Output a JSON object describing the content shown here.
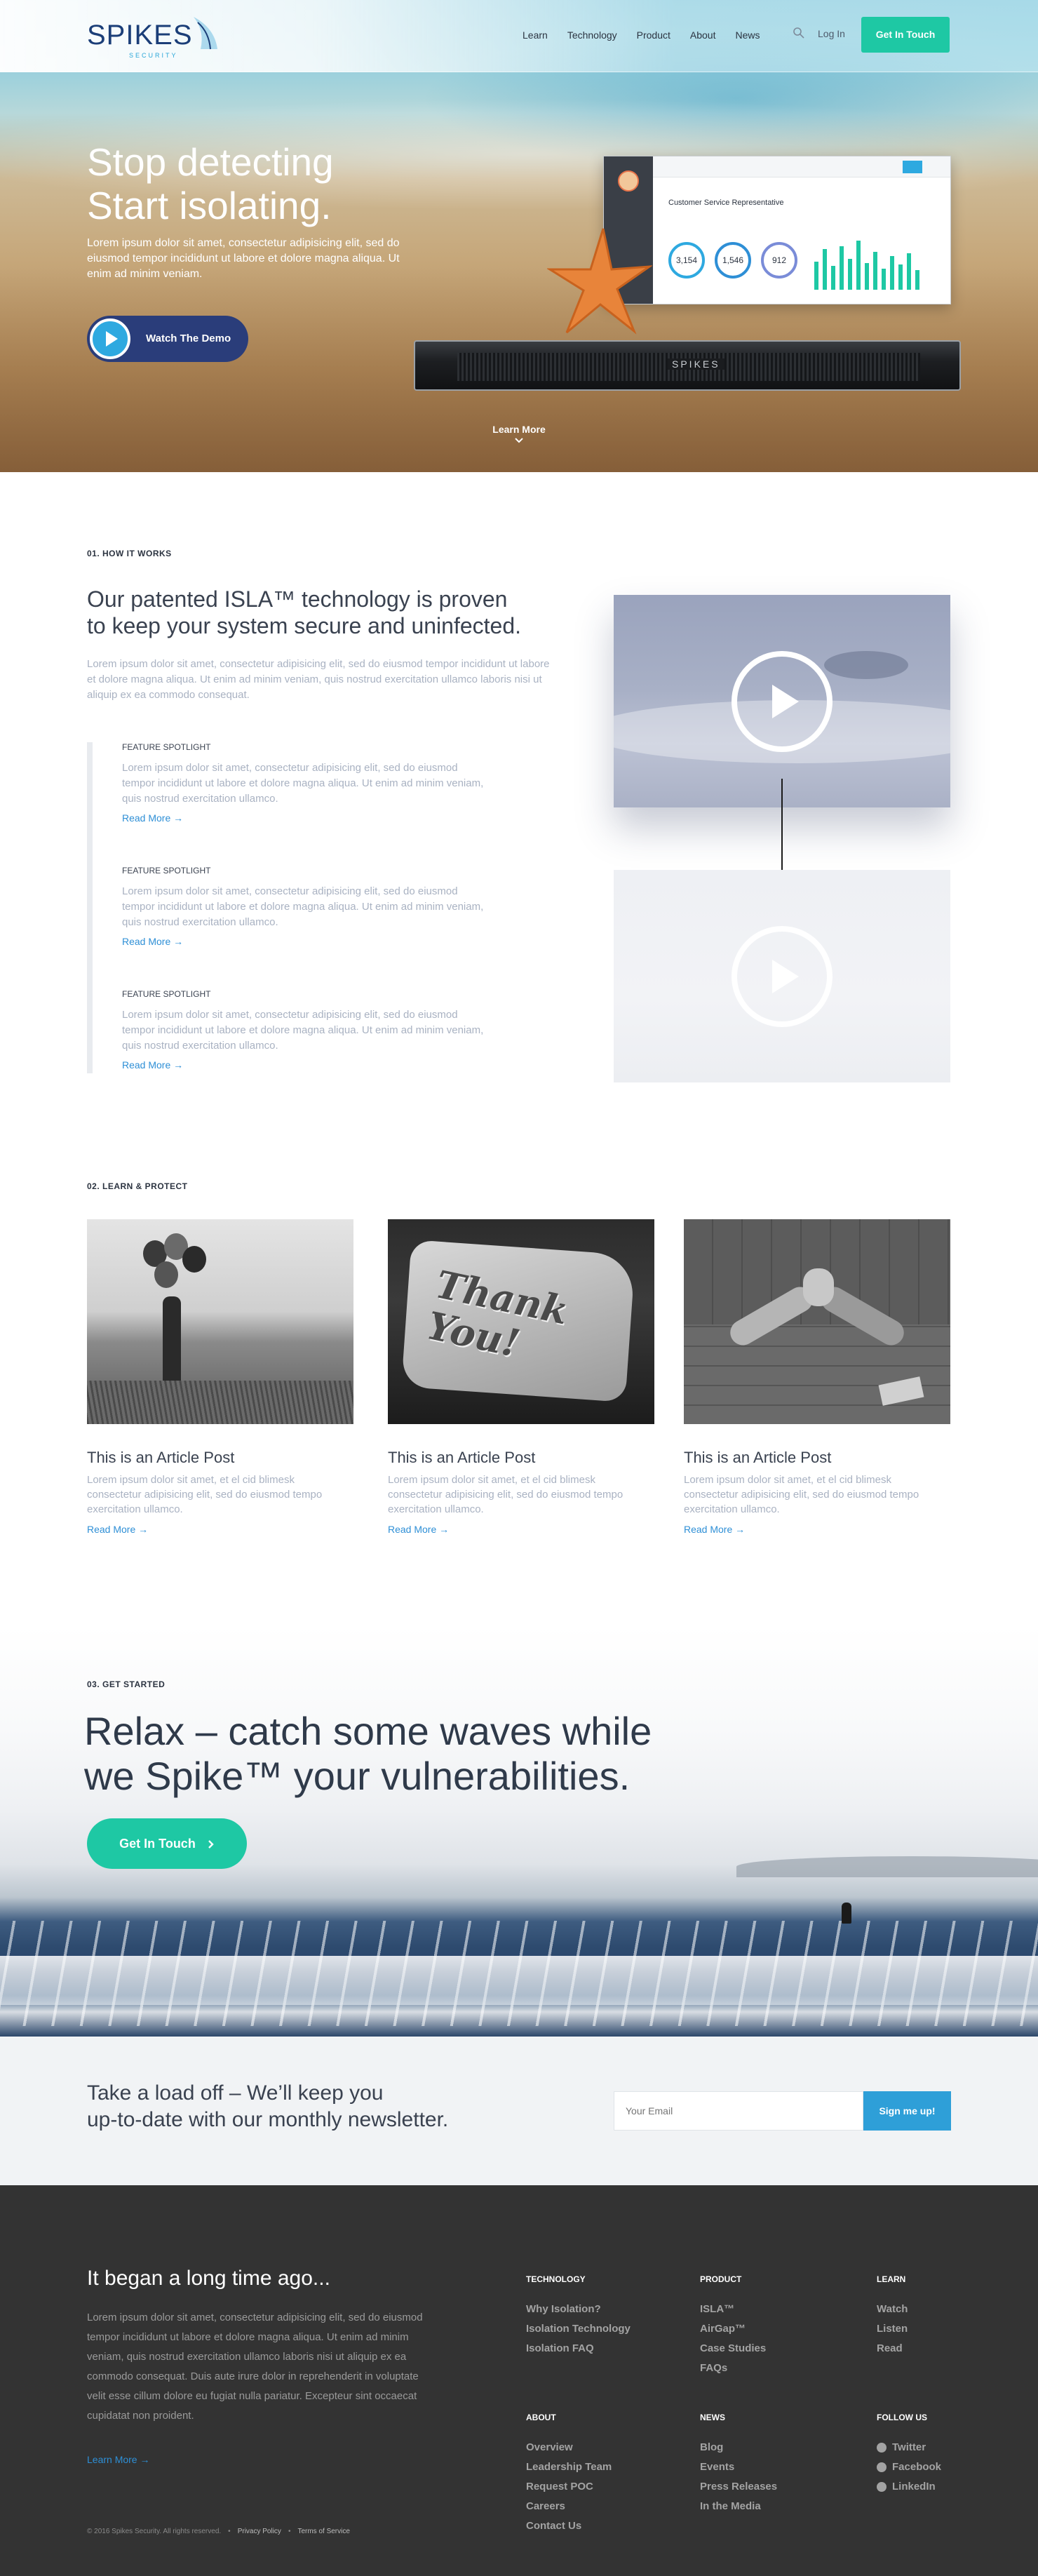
{
  "header": {
    "logo_text": "SPIKES",
    "logo_sub": "SECURITY",
    "nav": [
      "Learn",
      "Technology",
      "Product",
      "About",
      "News"
    ],
    "login": "Log In",
    "cta": "Get In Touch"
  },
  "hero": {
    "title_line1": "Stop detecting",
    "title_line2": "Start isolating.",
    "text": "Lorem ipsum dolor sit amet, consectetur adipisicing elit, sed do eiusmod tempor incididunt ut labore et dolore magna aliqua. Ut enim ad minim veniam.",
    "demo_label": "Watch The Demo",
    "learn_more": "Learn More",
    "device_label": "SPIKES",
    "dashboard": {
      "title": "Customer Service Representative",
      "stats": [
        "3,154",
        "1,546",
        "912"
      ]
    }
  },
  "how_it_works": {
    "eyebrow": "01. HOW IT WORKS",
    "title_line1": "Our patented ISLA™ technology is proven",
    "title_line2": "to keep your system secure and uninfected.",
    "text": "Lorem ipsum dolor sit amet, consectetur adipisicing elit, sed do eiusmod tempor incididunt ut labore et dolore magna aliqua. Ut enim ad minim veniam, quis nostrud exercitation ullamco laboris nisi ut aliquip ex ea commodo consequat.",
    "spotlights": [
      {
        "heading": "FEATURE SPOTLIGHT",
        "text": "Lorem ipsum dolor sit amet, consectetur adipisicing elit, sed do eiusmod tempor incididunt ut labore et dolore magna aliqua. Ut enim ad minim veniam, quis nostrud exercitation ullamco.",
        "link": "Read More →"
      },
      {
        "heading": "FEATURE SPOTLIGHT",
        "text": "Lorem ipsum dolor sit amet, consectetur adipisicing elit, sed do eiusmod tempor incididunt ut labore et dolore magna aliqua. Ut enim ad minim veniam, quis nostrud exercitation ullamco.",
        "link": "Read More →"
      },
      {
        "heading": "FEATURE SPOTLIGHT",
        "text": "Lorem ipsum dolor sit amet, consectetur adipisicing elit, sed do eiusmod tempor incididunt ut labore et dolore magna aliqua. Ut enim ad minim veniam, quis nostrud exercitation ullamco.",
        "link": "Read More →"
      }
    ]
  },
  "learn_protect": {
    "eyebrow": "02. LEARN & PROTECT",
    "articles": [
      {
        "title": "This is an Article Post",
        "text": "Lorem ipsum dolor sit amet, et el cid blimesk consectetur adipisicing elit, sed do eiusmod tempo exercitation ullamco.",
        "link": "Read More →"
      },
      {
        "title": "This is an Article Post",
        "text": "Lorem ipsum dolor sit amet, et el cid blimesk consectetur adipisicing elit, sed do eiusmod tempo exercitation ullamco.",
        "link": "Read More →"
      },
      {
        "title": "This is an Article Post",
        "text": "Lorem ipsum dolor sit amet, et el cid blimesk consectetur adipisicing elit, sed do eiusmod tempo exercitation ullamco.",
        "link": "Read More →"
      }
    ],
    "sign_text": "Thank You!"
  },
  "get_started": {
    "eyebrow": "03. GET STARTED",
    "title_line1": "Relax – catch some waves while",
    "title_line2": "we Spike™ your vulnerabilities.",
    "cta": "Get In Touch"
  },
  "newsletter": {
    "title_line1": "Take a load off – We’ll keep you",
    "title_line2": "up-to-date with our monthly newsletter.",
    "placeholder": "Your Email",
    "button": "Sign me up!"
  },
  "footer": {
    "title": "It began a long time ago...",
    "text": "Lorem ipsum dolor sit amet, consectetur adipisicing elit, sed do eiusmod tempor incididunt ut labore et dolore magna aliqua. Ut enim ad minim veniam, quis nostrud exercitation ullamco laboris nisi ut aliquip ex ea commodo consequat. Duis aute irure dolor in reprehenderit in voluptate velit esse cillum dolore eu fugiat nulla pariatur. Excepteur sint occaecat cupidatat non proident.",
    "more": "Learn More →",
    "copyright": "© 2016 Spikes Security. All rights reserved.",
    "privacy": "Privacy Policy",
    "terms": "Terms of Service",
    "columns": {
      "technology": {
        "heading": "TECHNOLOGY",
        "items": [
          "Why Isolation?",
          "Isolation Technology",
          "Isolation FAQ"
        ]
      },
      "product": {
        "heading": "PRODUCT",
        "items": [
          "ISLA™",
          "AirGap™",
          "Case Studies",
          "FAQs"
        ]
      },
      "learn": {
        "heading": "LEARN",
        "items": [
          "Watch",
          "Listen",
          "Read"
        ]
      },
      "about": {
        "heading": "ABOUT",
        "items": [
          "Overview",
          "Leadership Team",
          "Request POC",
          "Careers",
          "Contact Us"
        ]
      },
      "news": {
        "heading": "NEWS",
        "items": [
          "Blog",
          "Events",
          "Press Releases",
          "In the Media"
        ]
      },
      "follow": {
        "heading": "FOLLOW US",
        "items": [
          "Twitter",
          "Facebook",
          "LinkedIn"
        ]
      }
    }
  },
  "colors": {
    "accent_green": "#1ec8a4",
    "accent_blue": "#2e8fd6",
    "navy": "#2a3d7a",
    "footer_bg": "#333333"
  }
}
